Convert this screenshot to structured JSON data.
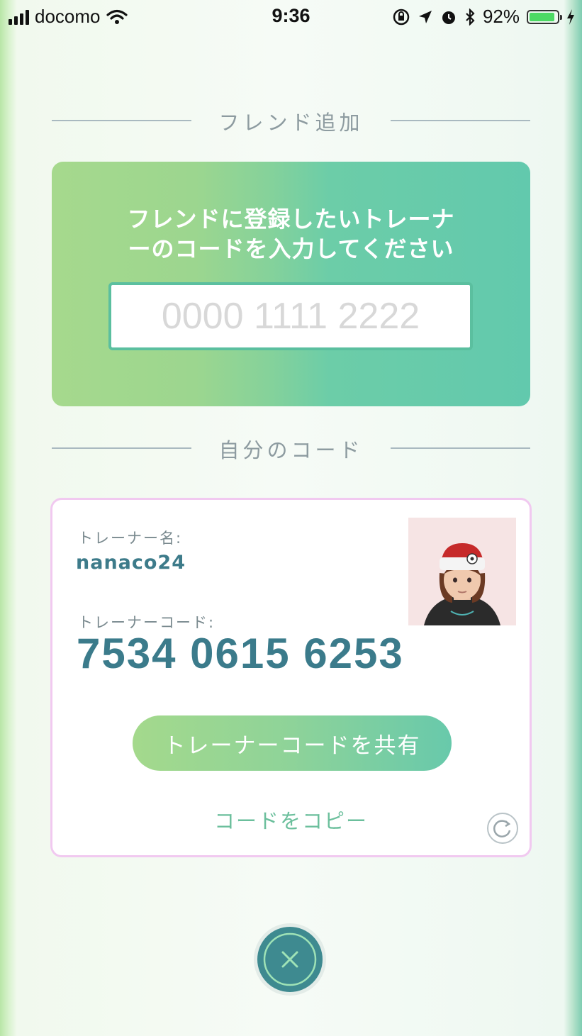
{
  "status_bar": {
    "carrier": "docomo",
    "time": "9:36",
    "battery_percent": "92%",
    "battery_level": 0.92,
    "icons": [
      "signal-icon",
      "wifi-icon",
      "rotation-lock-icon",
      "location-icon",
      "alarm-icon",
      "bluetooth-icon",
      "battery-icon",
      "charging-icon"
    ]
  },
  "friend_add": {
    "heading": "フレンド追加",
    "prompt_line1": "フレンドに登録したいトレーナ",
    "prompt_line2": "ーのコードを入力してください",
    "input_placeholder": "0000 1111 2222",
    "input_value": ""
  },
  "my_code": {
    "heading": "自分のコード",
    "trainer_name_label": "トレーナー名:",
    "trainer_name": "nanaco24",
    "trainer_code_label": "トレーナーコード:",
    "trainer_code": "7534 0615 6253",
    "share_button_label": "トレーナーコードを共有",
    "copy_link_label": "コードをコピー"
  },
  "colors": {
    "accent_teal": "#3b7b8b",
    "card_green": "#9cd68f",
    "card_teal": "#62c9ad",
    "card_border_pink": "#f1c9f0"
  }
}
